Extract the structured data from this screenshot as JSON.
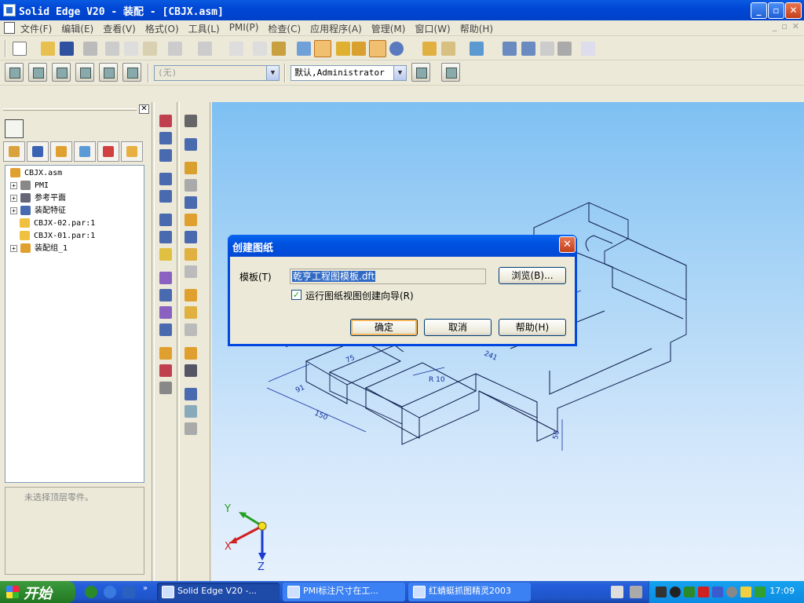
{
  "window": {
    "title": "Solid Edge V20 - 装配 - [CBJX.asm]"
  },
  "menu": {
    "items": [
      "文件(F)",
      "编辑(E)",
      "查看(V)",
      "格式(O)",
      "工具(L)",
      "PMI(P)",
      "检查(C)",
      "应用程序(A)",
      "管理(M)",
      "窗口(W)",
      "帮助(H)"
    ]
  },
  "toolbar2": {
    "style_value": "(无)",
    "user_value": "默认,Administrator"
  },
  "tree": {
    "items": [
      {
        "label": "CBJX.asm",
        "expand": false
      },
      {
        "label": "PMI",
        "expand": true
      },
      {
        "label": "参考平面",
        "expand": true
      },
      {
        "label": "装配特征",
        "expand": true
      },
      {
        "label": "CBJX-02.par:1",
        "expand": false
      },
      {
        "label": "CBJX-01.par:1",
        "expand": false
      },
      {
        "label": "装配组_1",
        "expand": true
      }
    ]
  },
  "status": {
    "text": "未选择顶层零件。"
  },
  "axes": {
    "x": "X",
    "y": "Y",
    "z": "Z"
  },
  "dimensions": [
    "75",
    "R 10",
    "91",
    "150",
    "241",
    "50"
  ],
  "dialog": {
    "title": "创建图纸",
    "template_label": "模板(T)",
    "template_value": "乾亨工程图模板.dft",
    "browse_button": "浏览(B)...",
    "checkbox_label": "运行图纸视图创建向导(R)",
    "ok_button": "确定",
    "cancel_button": "取消",
    "help_button": "帮助(H)"
  },
  "taskbar": {
    "start": "开始",
    "tasks": [
      "Solid Edge V20 -...",
      "PMI标注尺寸在工...",
      "红蜻蜓抓图精灵2003"
    ],
    "clock": "17:09"
  },
  "colors": {
    "title_bar": "#0047d6",
    "viewport_top": "#7ec0f3",
    "viewport_bottom": "#e6f1fc",
    "selection": "#316ac5",
    "model_edges": "#0a1a4a",
    "dimension_lines": "#1030a0"
  }
}
